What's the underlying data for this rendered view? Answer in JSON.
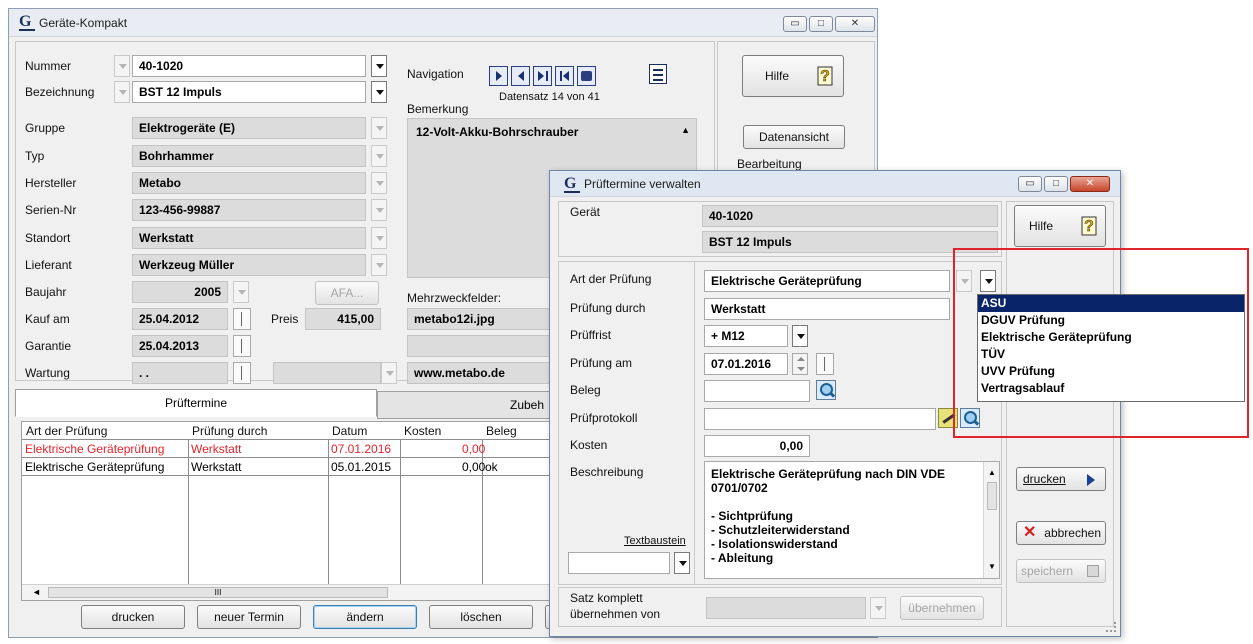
{
  "main": {
    "title": "Geräte-Kompakt",
    "labels": {
      "nummer": "Nummer",
      "bezeichnung": "Bezeichnung",
      "gruppe": "Gruppe",
      "typ": "Typ",
      "hersteller": "Hersteller",
      "serien": "Serien-Nr",
      "standort": "Standort",
      "lieferant": "Lieferant",
      "baujahr": "Baujahr",
      "kauf": "Kauf am",
      "garantie": "Garantie",
      "wartung": "Wartung",
      "preis": "Preis",
      "navigation": "Navigation",
      "bemerkung": "Bemerkung",
      "mehrzweck": "Mehrzweckfelder:"
    },
    "values": {
      "nummer": "40-1020",
      "bezeichnung": "BST 12 Impuls",
      "gruppe": "Elektrogeräte (E)",
      "typ": "Bohrhammer",
      "hersteller": "Metabo",
      "serien": "123-456-99887",
      "standort": "Werkstatt",
      "lieferant": "Werkzeug Müller",
      "baujahr": "2005",
      "kauf": "25.04.2012",
      "garantie": "25.04.2013",
      "wartung": ". .",
      "preis": "415,00",
      "bemerkung": "12-Volt-Akku-Bohrschrauber",
      "mehrzweck1": "metabo12i.jpg",
      "mehrzweck3": "www.metabo.de"
    },
    "afa_button": "AFA...",
    "datensatz": "Datensatz 14 von 41",
    "hilfe_button": "Hilfe",
    "datenansicht_button": "Datenansicht",
    "bearbeitung_label": "Bearbeitung",
    "tabs": [
      "Prüftermine",
      "Zubeh"
    ],
    "grid": {
      "headers": [
        "Art der Prüfung",
        "Prüfung durch",
        "Datum",
        "Kosten",
        "Beleg"
      ],
      "rows": [
        {
          "art": "Elektrische Geräteprüfung",
          "durch": "Werkstatt",
          "datum": "07.01.2016",
          "kosten": "0,00",
          "beleg": ""
        },
        {
          "art": "Elektrische Geräteprüfung",
          "durch": "Werkstatt",
          "datum": "05.01.2015",
          "kosten": "0,00",
          "beleg": "ok"
        }
      ],
      "scroll_glyph": "III"
    },
    "buttons": {
      "drucken": "drucken",
      "neuer_termin": "neuer Termin",
      "aendern": "ändern",
      "loeschen": "löschen"
    }
  },
  "dialog": {
    "title": "Prüftermine verwalten",
    "labels": {
      "geraet": "Gerät",
      "art": "Art der Prüfung",
      "durch": "Prüfung durch",
      "frist": "Prüffrist",
      "am": "Prüfung am",
      "beleg": "Beleg",
      "protokoll": "Prüfprotokoll",
      "kosten": "Kosten",
      "beschreibung": "Beschreibung",
      "textbaustein": "Textbaustein",
      "satz": "Satz komplett",
      "uebernehmen_von": "übernehmen von"
    },
    "values": {
      "geraet_nr": "40-1020",
      "geraet_name": "BST 12 Impuls",
      "art": "Elektrische Geräteprüfung",
      "durch": "Werkstatt",
      "frist": "+ M12",
      "am": "07.01.2016",
      "kosten": "0,00",
      "beschreibung": [
        "Elektrische Geräteprüfung nach DIN VDE",
        "0701/0702",
        "",
        "- Sichtprüfung",
        "- Schutzleiterwiderstand",
        "- Isolationswiderstand",
        "- Ableitung"
      ]
    },
    "buttons": {
      "hilfe": "Hilfe",
      "drucken": "drucken",
      "abbrechen": "abbrechen",
      "speichern": "speichern",
      "uebernehmen": "übernehmen"
    },
    "dropdown_options": [
      "ASU",
      "DGUV Prüfung",
      "Elektrische Geräteprüfung",
      "TÜV",
      "UVV Prüfung",
      "Vertragsablauf"
    ],
    "selected_option": "ASU"
  },
  "colors": {
    "highlight_red": "#e0242c",
    "selection_navy": "#0a246a",
    "row_red_text": "#e0242c"
  }
}
